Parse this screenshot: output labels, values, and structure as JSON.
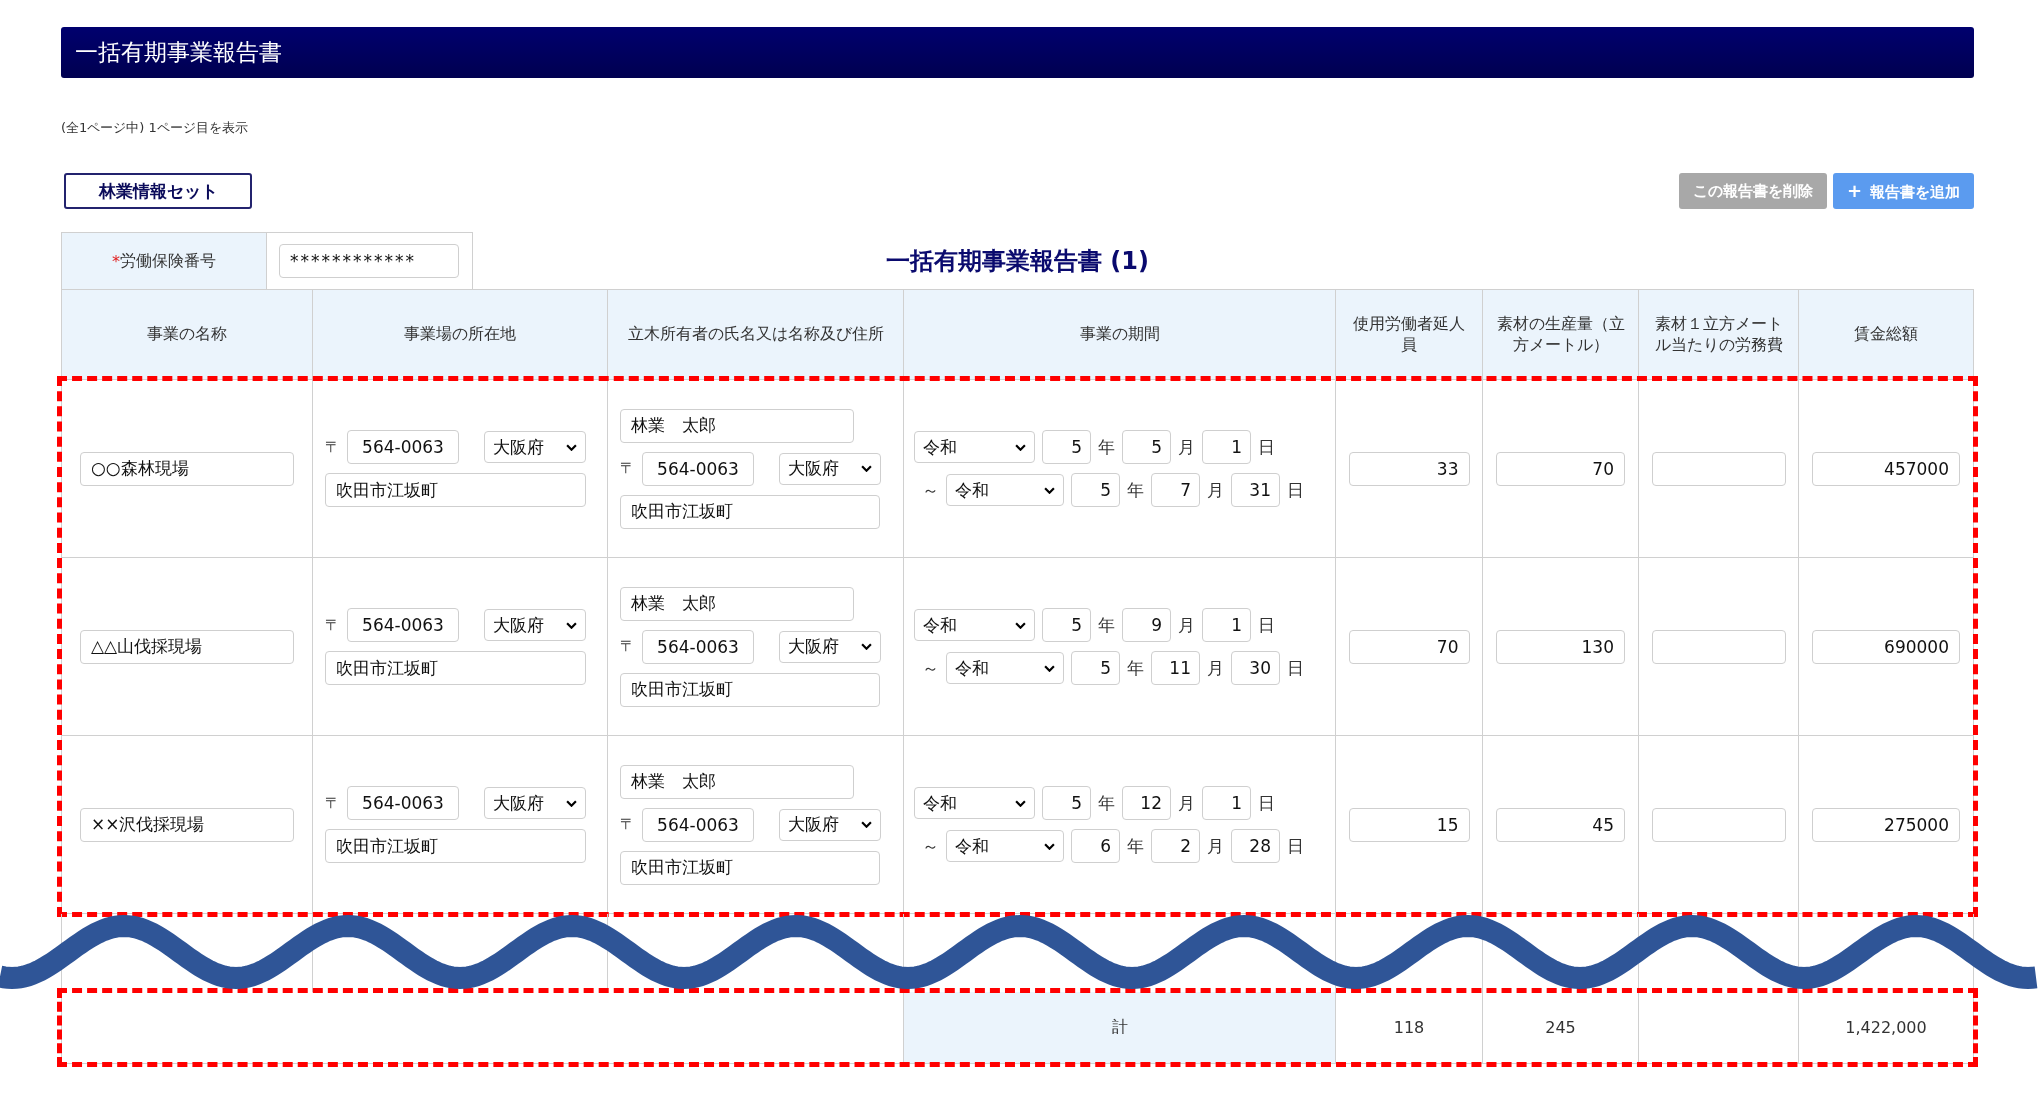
{
  "header": {
    "title": "一括有期事業報告書"
  },
  "page_info": "(全1ページ中) 1ページ目を表示",
  "buttons": {
    "forestry_set": "林業情報セット",
    "delete": {
      "label": "この報告書を削除",
      "disabled": true
    },
    "add": {
      "icon": "+",
      "label": "報告書を追加",
      "disabled": false
    }
  },
  "insurance": {
    "required_mark": "*",
    "label": "労働保険番号",
    "value": "************"
  },
  "report_title": "一括有期事業報告書 (1)",
  "table": {
    "columns": [
      "事業の名称",
      "事業場の所在地",
      "立木所有者の氏名又は名称及び住所",
      "事業の期間",
      "使用労働者延人員",
      "素材の生産量（立方メートル）",
      "素材１立方メートル当たりの労務費",
      "賃金総額"
    ],
    "rows": [
      {
        "name": "○○森林現場",
        "location": {
          "postal_mark": "〒",
          "postal": "564-0063",
          "prefecture": "大阪府",
          "address": "吹田市江坂町"
        },
        "owner": {
          "name": "林業　太郎",
          "postal_mark": "〒",
          "postal": "564-0063",
          "prefecture": "大阪府",
          "address": "吹田市江坂町"
        },
        "period": {
          "start": {
            "era": "令和",
            "parts": [
              {
                "value": "5",
                "unit": "年"
              },
              {
                "value": "5",
                "unit": "月"
              },
              {
                "value": "1",
                "unit": "日"
              }
            ]
          },
          "separator": "～",
          "end": {
            "era": "令和",
            "parts": [
              {
                "value": "5",
                "unit": "年"
              },
              {
                "value": "7",
                "unit": "月"
              },
              {
                "value": "31",
                "unit": "日"
              }
            ]
          }
        },
        "workers": "33",
        "production": "70",
        "wages": "457000"
      },
      {
        "name": "△△山伐採現場",
        "location": {
          "postal_mark": "〒",
          "postal": "564-0063",
          "prefecture": "大阪府",
          "address": "吹田市江坂町"
        },
        "owner": {
          "name": "林業　太郎",
          "postal_mark": "〒",
          "postal": "564-0063",
          "prefecture": "大阪府",
          "address": "吹田市江坂町"
        },
        "period": {
          "start": {
            "era": "令和",
            "parts": [
              {
                "value": "5",
                "unit": "年"
              },
              {
                "value": "9",
                "unit": "月"
              },
              {
                "value": "1",
                "unit": "日"
              }
            ]
          },
          "separator": "～",
          "end": {
            "era": "令和",
            "parts": [
              {
                "value": "5",
                "unit": "年"
              },
              {
                "value": "11",
                "unit": "月"
              },
              {
                "value": "30",
                "unit": "日"
              }
            ]
          }
        },
        "workers": "70",
        "production": "130",
        "wages": "690000"
      },
      {
        "name": "××沢伐採現場",
        "location": {
          "postal_mark": "〒",
          "postal": "564-0063",
          "prefecture": "大阪府",
          "address": "吹田市江坂町"
        },
        "owner": {
          "name": "林業　太郎",
          "postal_mark": "〒",
          "postal": "564-0063",
          "prefecture": "大阪府",
          "address": "吹田市江坂町"
        },
        "period": {
          "start": {
            "era": "令和",
            "parts": [
              {
                "value": "5",
                "unit": "年"
              },
              {
                "value": "12",
                "unit": "月"
              },
              {
                "value": "1",
                "unit": "日"
              }
            ]
          },
          "separator": "～",
          "end": {
            "era": "令和",
            "parts": [
              {
                "value": "6",
                "unit": "年"
              },
              {
                "value": "2",
                "unit": "月"
              },
              {
                "value": "28",
                "unit": "日"
              }
            ]
          }
        },
        "workers": "15",
        "production": "45",
        "wages": "275000"
      }
    ],
    "total": {
      "label": "計",
      "workers": "118",
      "production": "245",
      "wages": "1,422,000"
    }
  }
}
